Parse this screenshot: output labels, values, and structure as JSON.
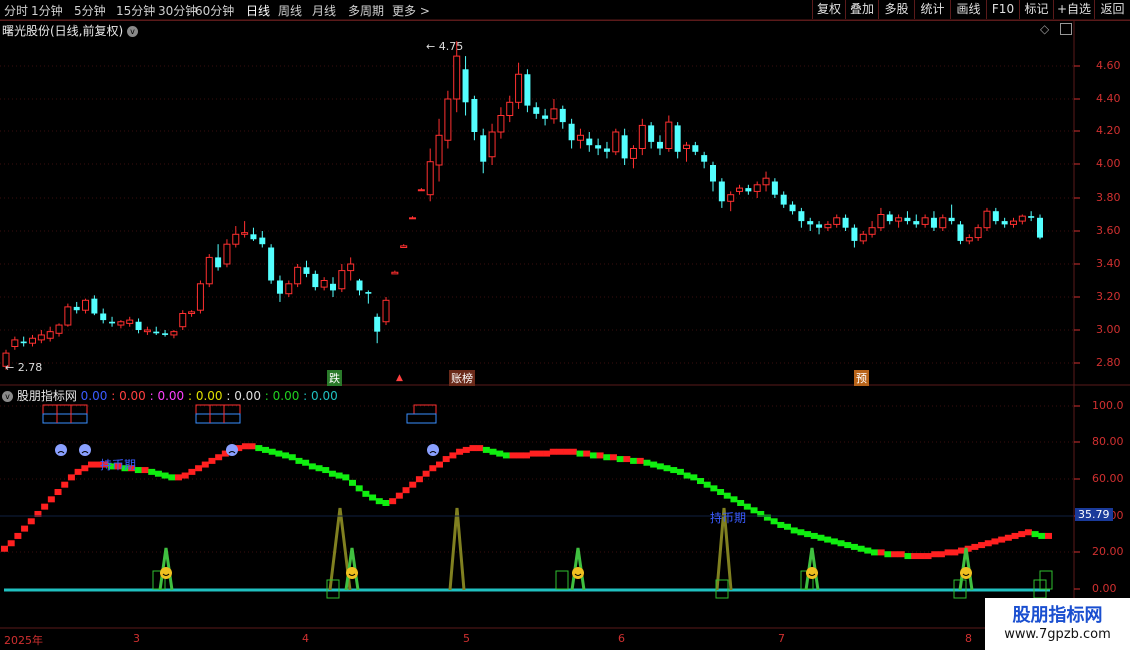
{
  "toolbar": {
    "timeframes": [
      "分时",
      "1分钟",
      "5分钟",
      "15分钟",
      "30分钟",
      "60分钟",
      "日线",
      "周线",
      "月线",
      "多周期",
      "更多 >"
    ],
    "active_timeframe": "日线",
    "right_buttons": [
      "复权",
      "叠加",
      "多股",
      "统计",
      "画线",
      "F10",
      "标记",
      "+自选",
      "返回"
    ]
  },
  "main_panel": {
    "title": "曙光股份(日线,前复权)",
    "high_label": "4.75",
    "low_label": "2.78",
    "y_axis": [
      "4.60",
      "4.40",
      "4.20",
      "4.00",
      "3.80",
      "3.60",
      "3.40",
      "3.20",
      "3.00",
      "2.80"
    ],
    "markers": {
      "die": "跌",
      "zhangbang": "账榜",
      "yu": "预"
    }
  },
  "indicator_panel": {
    "title": "股朋指标网",
    "values": [
      "0.00",
      "0.00",
      "0.00",
      "0.00",
      "0.00",
      "0.00",
      "0.00"
    ],
    "value_colors": [
      "#3a5bff",
      "#ff4040",
      "#ff40ff",
      "#e0e000",
      "#e0e0e0",
      "#20d020",
      "#20c0c0"
    ],
    "y_axis": [
      "100.0",
      "80.00",
      "60.00",
      "40.00",
      "20.00",
      "0.00"
    ],
    "current_value": "35.79",
    "text_labels": [
      "持币期",
      "持币期"
    ]
  },
  "date_axis": [
    "2025年",
    "3",
    "4",
    "5",
    "6",
    "7",
    "8"
  ],
  "watermark": {
    "line1": "股朋指标网",
    "line2": "www.7gpzb.com"
  },
  "colors": {
    "up": "#ff3030",
    "down": "#54ffff",
    "axis": "#d03030",
    "grid": "#5a1a1a"
  },
  "chart_data": {
    "type": "candlestick",
    "ylim": [
      2.7,
      4.8
    ],
    "candles": [
      [
        2.78,
        2.88,
        2.76,
        2.86
      ],
      [
        2.9,
        2.96,
        2.88,
        2.94
      ],
      [
        2.93,
        2.96,
        2.9,
        2.92
      ],
      [
        2.92,
        2.97,
        2.9,
        2.95
      ],
      [
        2.94,
        3.0,
        2.92,
        2.97
      ],
      [
        2.95,
        3.02,
        2.93,
        2.99
      ],
      [
        2.98,
        3.04,
        2.96,
        3.03
      ],
      [
        3.03,
        3.16,
        3.02,
        3.14
      ],
      [
        3.14,
        3.17,
        3.1,
        3.12
      ],
      [
        3.12,
        3.19,
        3.1,
        3.18
      ],
      [
        3.19,
        3.21,
        3.09,
        3.1
      ],
      [
        3.1,
        3.13,
        3.04,
        3.06
      ],
      [
        3.05,
        3.08,
        3.02,
        3.04
      ],
      [
        3.03,
        3.06,
        3.01,
        3.05
      ],
      [
        3.04,
        3.08,
        3.02,
        3.06
      ],
      [
        3.05,
        3.07,
        2.98,
        3.0
      ],
      [
        2.99,
        3.02,
        2.97,
        3.0
      ],
      [
        2.99,
        3.02,
        2.97,
        2.98
      ],
      [
        2.98,
        3.0,
        2.96,
        2.97
      ],
      [
        2.97,
        3.0,
        2.95,
        2.99
      ],
      [
        3.02,
        3.12,
        3.0,
        3.1
      ],
      [
        3.1,
        3.12,
        3.08,
        3.11
      ],
      [
        3.12,
        3.3,
        3.1,
        3.28
      ],
      [
        3.28,
        3.46,
        3.26,
        3.44
      ],
      [
        3.44,
        3.52,
        3.36,
        3.38
      ],
      [
        3.4,
        3.55,
        3.38,
        3.52
      ],
      [
        3.52,
        3.63,
        3.5,
        3.58
      ],
      [
        3.58,
        3.66,
        3.56,
        3.59
      ],
      [
        3.58,
        3.62,
        3.54,
        3.55
      ],
      [
        3.56,
        3.6,
        3.5,
        3.52
      ],
      [
        3.5,
        3.52,
        3.28,
        3.3
      ],
      [
        3.3,
        3.33,
        3.17,
        3.22
      ],
      [
        3.22,
        3.3,
        3.2,
        3.28
      ],
      [
        3.28,
        3.4,
        3.26,
        3.38
      ],
      [
        3.38,
        3.42,
        3.32,
        3.34
      ],
      [
        3.34,
        3.36,
        3.24,
        3.26
      ],
      [
        3.26,
        3.32,
        3.24,
        3.3
      ],
      [
        3.28,
        3.32,
        3.2,
        3.24
      ],
      [
        3.25,
        3.4,
        3.23,
        3.36
      ],
      [
        3.36,
        3.44,
        3.3,
        3.4
      ],
      [
        3.3,
        3.31,
        3.21,
        3.24
      ],
      [
        3.23,
        3.24,
        3.16,
        3.22
      ],
      [
        3.08,
        3.1,
        2.92,
        2.99
      ],
      [
        3.05,
        3.2,
        3.03,
        3.18
      ],
      [
        3.34,
        3.36,
        3.34,
        3.35
      ],
      [
        3.5,
        3.52,
        3.5,
        3.51
      ],
      [
        3.68,
        3.69,
        3.68,
        3.68
      ],
      [
        3.85,
        3.86,
        3.85,
        3.85
      ],
      [
        3.82,
        4.1,
        3.78,
        4.02
      ],
      [
        4.0,
        4.28,
        3.9,
        4.18
      ],
      [
        4.15,
        4.45,
        4.1,
        4.4
      ],
      [
        4.4,
        4.75,
        4.32,
        4.66
      ],
      [
        4.58,
        4.66,
        4.3,
        4.38
      ],
      [
        4.4,
        4.42,
        4.15,
        4.2
      ],
      [
        4.18,
        4.22,
        3.95,
        4.02
      ],
      [
        4.05,
        4.25,
        4.0,
        4.2
      ],
      [
        4.2,
        4.35,
        4.16,
        4.3
      ],
      [
        4.3,
        4.42,
        4.26,
        4.38
      ],
      [
        4.38,
        4.62,
        4.34,
        4.55
      ],
      [
        4.55,
        4.58,
        4.32,
        4.36
      ],
      [
        4.35,
        4.38,
        4.28,
        4.31
      ],
      [
        4.3,
        4.34,
        4.24,
        4.28
      ],
      [
        4.28,
        4.4,
        4.25,
        4.34
      ],
      [
        4.34,
        4.36,
        4.22,
        4.26
      ],
      [
        4.25,
        4.28,
        4.1,
        4.15
      ],
      [
        4.15,
        4.22,
        4.1,
        4.18
      ],
      [
        4.16,
        4.2,
        4.08,
        4.12
      ],
      [
        4.12,
        4.16,
        4.06,
        4.1
      ],
      [
        4.1,
        4.14,
        4.04,
        4.08
      ],
      [
        4.08,
        4.22,
        4.06,
        4.2
      ],
      [
        4.18,
        4.22,
        4.0,
        4.04
      ],
      [
        4.04,
        4.12,
        3.98,
        4.1
      ],
      [
        4.1,
        4.28,
        4.06,
        4.24
      ],
      [
        4.24,
        4.26,
        4.1,
        4.14
      ],
      [
        4.14,
        4.18,
        4.06,
        4.1
      ],
      [
        4.1,
        4.3,
        4.08,
        4.26
      ],
      [
        4.24,
        4.26,
        4.04,
        4.08
      ],
      [
        4.1,
        4.14,
        4.02,
        4.12
      ],
      [
        4.12,
        4.14,
        4.06,
        4.08
      ],
      [
        4.06,
        4.08,
        3.98,
        4.02
      ],
      [
        4.0,
        4.02,
        3.84,
        3.9
      ],
      [
        3.9,
        3.92,
        3.74,
        3.78
      ],
      [
        3.78,
        3.84,
        3.72,
        3.82
      ],
      [
        3.84,
        3.88,
        3.82,
        3.86
      ],
      [
        3.86,
        3.88,
        3.82,
        3.84
      ],
      [
        3.84,
        3.9,
        3.8,
        3.88
      ],
      [
        3.88,
        3.96,
        3.84,
        3.92
      ],
      [
        3.9,
        3.92,
        3.8,
        3.82
      ],
      [
        3.82,
        3.84,
        3.74,
        3.76
      ],
      [
        3.76,
        3.78,
        3.7,
        3.72
      ],
      [
        3.72,
        3.74,
        3.62,
        3.66
      ],
      [
        3.66,
        3.68,
        3.6,
        3.64
      ],
      [
        3.64,
        3.66,
        3.58,
        3.62
      ],
      [
        3.62,
        3.66,
        3.6,
        3.64
      ],
      [
        3.64,
        3.7,
        3.62,
        3.68
      ],
      [
        3.68,
        3.7,
        3.6,
        3.62
      ],
      [
        3.62,
        3.64,
        3.5,
        3.54
      ],
      [
        3.54,
        3.6,
        3.52,
        3.58
      ],
      [
        3.58,
        3.66,
        3.56,
        3.62
      ],
      [
        3.62,
        3.74,
        3.6,
        3.7
      ],
      [
        3.7,
        3.72,
        3.64,
        3.66
      ],
      [
        3.66,
        3.7,
        3.62,
        3.68
      ],
      [
        3.68,
        3.72,
        3.64,
        3.66
      ],
      [
        3.66,
        3.7,
        3.62,
        3.64
      ],
      [
        3.64,
        3.7,
        3.62,
        3.68
      ],
      [
        3.68,
        3.72,
        3.6,
        3.62
      ],
      [
        3.62,
        3.7,
        3.6,
        3.68
      ],
      [
        3.68,
        3.76,
        3.64,
        3.66
      ],
      [
        3.64,
        3.66,
        3.52,
        3.54
      ],
      [
        3.54,
        3.58,
        3.52,
        3.56
      ],
      [
        3.56,
        3.64,
        3.54,
        3.62
      ],
      [
        3.62,
        3.74,
        3.6,
        3.72
      ],
      [
        3.72,
        3.74,
        3.64,
        3.66
      ],
      [
        3.66,
        3.68,
        3.62,
        3.64
      ],
      [
        3.64,
        3.68,
        3.62,
        3.66
      ],
      [
        3.66,
        3.7,
        3.64,
        3.69
      ],
      [
        3.69,
        3.72,
        3.66,
        3.68
      ],
      [
        3.68,
        3.7,
        3.55,
        3.56
      ]
    ],
    "indicator_line": [
      22,
      25,
      29,
      33,
      37,
      41,
      45,
      49,
      53,
      57,
      61,
      64,
      66,
      68,
      68,
      68,
      67,
      67,
      66,
      66,
      65,
      65,
      64,
      63,
      62,
      61,
      61,
      62,
      64,
      66,
      68,
      70,
      72,
      74,
      76,
      77,
      78,
      78,
      77,
      76,
      75,
      74,
      73,
      72,
      70,
      69,
      67,
      66,
      65,
      63,
      62,
      61,
      58,
      55,
      52,
      50,
      48,
      47,
      48,
      51,
      54,
      57,
      60,
      63,
      66,
      68,
      71,
      73,
      75,
      76,
      77,
      77,
      76,
      75,
      74,
      73,
      73,
      73,
      73,
      74,
      74,
      74,
      75,
      75,
      75,
      75,
      74,
      74,
      73,
      73,
      72,
      72,
      71,
      71,
      70,
      70,
      69,
      68,
      67,
      66,
      65,
      64,
      62,
      61,
      59,
      57,
      55,
      53,
      51,
      49,
      47,
      45,
      43,
      41,
      39,
      37,
      35,
      34,
      32,
      31,
      30,
      29,
      28,
      27,
      26,
      25,
      24,
      23,
      22,
      21,
      20,
      20,
      19,
      19,
      19,
      18,
      18,
      18,
      18,
      19,
      19,
      20,
      20,
      21,
      22,
      23,
      24,
      25,
      26,
      27,
      28,
      29,
      30,
      31,
      30,
      29,
      29
    ]
  }
}
